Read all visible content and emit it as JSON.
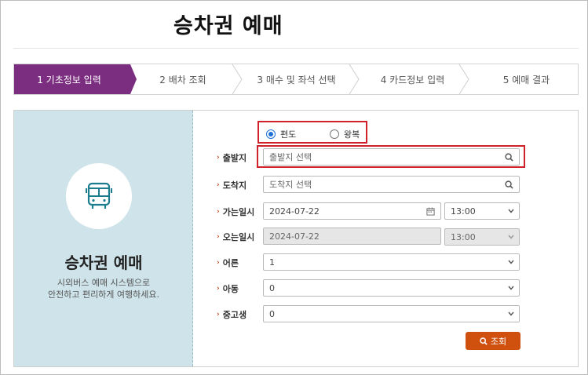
{
  "page": {
    "title": "승차권 예매"
  },
  "steps": [
    {
      "label": "1 기초정보 입력",
      "active": true
    },
    {
      "label": "2 배차 조회",
      "active": false
    },
    {
      "label": "3 매수 및 좌석 선택",
      "active": false
    },
    {
      "label": "4 카드정보 입력",
      "active": false
    },
    {
      "label": "5 예매 결과",
      "active": false
    }
  ],
  "left": {
    "title": "승차권 예매",
    "desc_line1": "시외버스 예매 시스템으로",
    "desc_line2": "안전하고 편리하게 여행하세요."
  },
  "trip_type": {
    "one_way": "편도",
    "round_trip": "왕복",
    "selected": "one_way"
  },
  "form": {
    "departure": {
      "label": "출발지",
      "placeholder": "출발지 선택"
    },
    "arrival": {
      "label": "도착지",
      "placeholder": "도착지 선택"
    },
    "go_date": {
      "label": "가는일시",
      "date": "2024-07-22",
      "time": "13:00"
    },
    "return_date": {
      "label": "오는일시",
      "date": "2024-07-22",
      "time": "13:00"
    },
    "adult": {
      "label": "어른",
      "value": "1"
    },
    "child": {
      "label": "아동",
      "value": "0"
    },
    "student": {
      "label": "중고생",
      "value": "0"
    }
  },
  "search_button": {
    "label": "조회"
  },
  "colors": {
    "accent": "#7b2d7f",
    "highlight": "#d0202a",
    "button": "#d0500e",
    "left_pane": "#cfe4ea"
  }
}
